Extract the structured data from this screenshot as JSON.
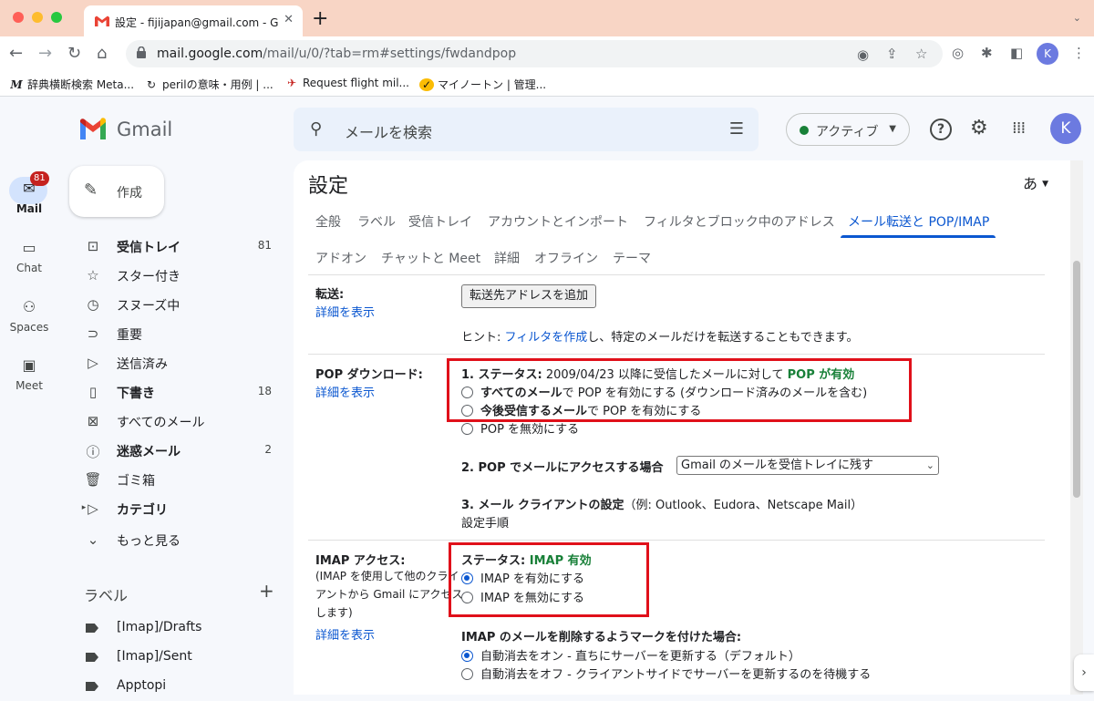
{
  "browser": {
    "tab_title": "設定 - fijijapan@gmail.com - Gm",
    "url_host": "mail.google.com",
    "url_path": "/mail/u/0/?tab=rm#settings/fwdandpop",
    "profile_initial": "K",
    "bookmarks": [
      {
        "label": "辞典横断検索 Meta...",
        "icon": "M"
      },
      {
        "label": "perilの意味・用例 | ...",
        "icon": "↻"
      },
      {
        "label": "Request flight mil...",
        "icon": "✈"
      },
      {
        "label": "マイノートン | 管理...",
        "icon": "✓"
      }
    ]
  },
  "gmail": {
    "brand": "Gmail",
    "search_placeholder": "メールを検索",
    "status": "アクティブ",
    "account_initial": "K",
    "rail": [
      {
        "label": "Mail",
        "icon": "mail-icon",
        "badge": "81"
      },
      {
        "label": "Chat",
        "icon": "chat-icon"
      },
      {
        "label": "Spaces",
        "icon": "spaces-icon"
      },
      {
        "label": "Meet",
        "icon": "meet-icon"
      }
    ],
    "compose": "作成",
    "nav": [
      {
        "label": "受信トレイ",
        "count": "81",
        "bold": true,
        "icon": "inbox-icon"
      },
      {
        "label": "スター付き",
        "count": "",
        "icon": "star-icon"
      },
      {
        "label": "スヌーズ中",
        "count": "",
        "icon": "clock-icon"
      },
      {
        "label": "重要",
        "count": "",
        "icon": "important-icon"
      },
      {
        "label": "送信済み",
        "count": "",
        "icon": "send-icon"
      },
      {
        "label": "下書き",
        "count": "18",
        "bold": true,
        "icon": "draft-icon"
      },
      {
        "label": "すべてのメール",
        "count": "",
        "icon": "all-mail-icon"
      },
      {
        "label": "迷惑メール",
        "count": "2",
        "bold": true,
        "icon": "spam-icon"
      },
      {
        "label": "ゴミ箱",
        "count": "",
        "icon": "trash-icon"
      },
      {
        "label": "カテゴリ",
        "count": "",
        "bold": true,
        "icon": "category-icon"
      },
      {
        "label": "もっと見る",
        "count": "",
        "icon": "chevron-down-icon"
      }
    ],
    "labels_header": "ラベル",
    "labels": [
      "[Imap]/Drafts",
      "[Imap]/Sent",
      "Apptopi"
    ]
  },
  "settings": {
    "title": "設定",
    "ime": "あ",
    "tabs_row1": [
      "全般",
      "ラベル",
      "受信トレイ",
      "アカウントとインポート",
      "フィルタとブロック中のアドレス",
      "メール転送と POP/IMAP"
    ],
    "tabs_row2": [
      "アドオン",
      "チャットと Meet",
      "詳細",
      "オフライン",
      "テーマ"
    ],
    "forwarding": {
      "title": "転送:",
      "link": "詳細を表示",
      "button": "転送先アドレスを追加",
      "hint_pre": "ヒント: ",
      "hint_link": "フィルタを作成",
      "hint_post": "し、特定のメールだけを転送することもできます。"
    },
    "pop": {
      "title": "POP ダウンロード:",
      "link": "詳細を表示",
      "status_prefix": "1. ステータス:",
      "status_text": " 2009/04/23 以降に受信したメールに対して ",
      "status_value": "POP が有効",
      "opt1_bold": "すべてのメール",
      "opt1_rest": "で POP を有効にする (ダウンロード済みのメールを含む)",
      "opt2_bold": "今後受信するメール",
      "opt2_rest": "で POP を有効にする",
      "opt3": "POP を無効にする",
      "access_label": "2. POP でメールにアクセスする場合",
      "access_select": "Gmail のメールを受信トレイに残す",
      "client_label": "3. メール クライアントの設定",
      "client_examples": "（例: Outlook、Eudora、Netscape Mail）",
      "client_link": "設定手順"
    },
    "imap": {
      "title": "IMAP アクセス:",
      "desc_line1": "(IMAP を使用して他のクライ",
      "desc_line2": "アントから Gmail にアクセス",
      "desc_line3": "します)",
      "link": "詳細を表示",
      "status_prefix": "ステータス: ",
      "status_value": "IMAP 有効",
      "opt_on": "IMAP を有効にする",
      "opt_off": "IMAP を無効にする",
      "delete_label": "IMAP のメールを削除するようマークを付けた場合:",
      "delete_opt1": "自動消去をオン - 直ちにサーバーを更新する（デフォルト）",
      "delete_opt2": "自動消去をオフ - クライアントサイドでサーバーを更新するのを待機する"
    }
  },
  "colors": {
    "highlight_box": "#e0101a",
    "enabled_green": "#188038",
    "link_blue": "#0b57d0"
  }
}
